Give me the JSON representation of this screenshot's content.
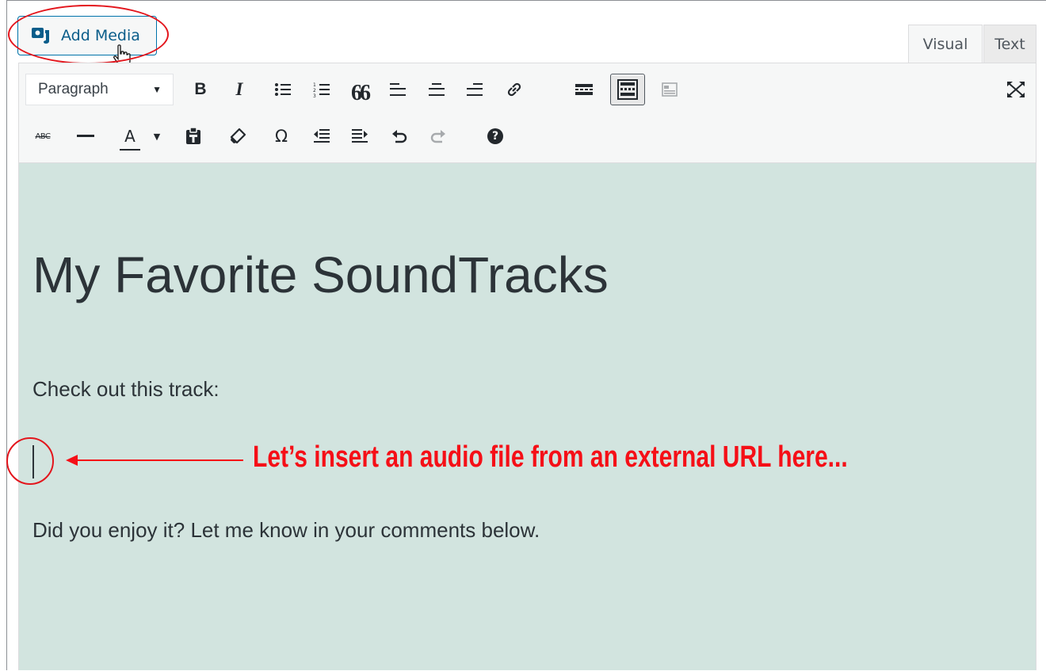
{
  "add_media": {
    "label": "Add Media"
  },
  "tabs": [
    {
      "label": "Visual",
      "active": true
    },
    {
      "label": "Text",
      "active": false
    }
  ],
  "toolbar": {
    "format_select": {
      "value": "Paragraph"
    },
    "row1": [
      "bold-icon",
      "italic-icon",
      "bullet-list-icon",
      "numbered-list-icon",
      "blockquote-icon",
      "align-left-icon",
      "align-center-icon",
      "align-right-icon",
      "link-icon",
      "read-more-icon",
      "toolbar-toggle-icon",
      "media-icon",
      "fullscreen-icon"
    ],
    "row2": [
      "strikethrough-icon",
      "horizontal-line-icon",
      "text-color-icon",
      "paste-text-icon",
      "clear-formatting-icon",
      "special-character-icon",
      "outdent-icon",
      "indent-icon",
      "undo-icon",
      "redo-icon",
      "help-icon"
    ],
    "glyphs": {
      "bold": "B",
      "italic": "I",
      "quote": "66",
      "omega": "Ω",
      "abc": "ABC",
      "color_a": "A",
      "help": "?"
    }
  },
  "content": {
    "heading": "My Favorite SoundTracks",
    "paragraph1": "Check out this track:",
    "paragraph2": "Did you enjoy it? Let me know in your comments below."
  },
  "annotation": {
    "text": "Let’s insert an audio file from an external URL here...",
    "color": "#f50f17"
  }
}
